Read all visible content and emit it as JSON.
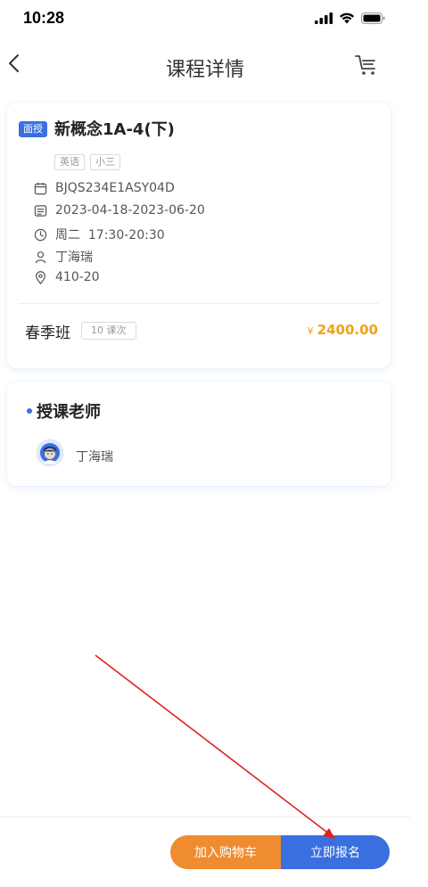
{
  "status_bar": {
    "time": "10:28"
  },
  "nav": {
    "title": "课程详情"
  },
  "course": {
    "mode_badge": "面授",
    "title": "新概念1A-4(下)",
    "tags": [
      "英语",
      "小三"
    ],
    "info": [
      {
        "icon": "calendar-icon",
        "text": "BJQS234E1ASY04D"
      },
      {
        "icon": "date-range-icon",
        "text": "2023-04-18-2023-06-20"
      },
      {
        "icon": "clock-icon",
        "text": "周二  17:30-20:30"
      },
      {
        "icon": "person-icon",
        "text": "丁海瑞"
      },
      {
        "icon": "location-icon",
        "text": "410-20"
      }
    ],
    "term": "春季班",
    "lesson_count": "10 课次",
    "price_currency": "¥",
    "price": "2400.00"
  },
  "teacher_section": {
    "title": "授课老师",
    "teacher_name": "丁海瑞"
  },
  "bottom_bar": {
    "add_to_cart_label": "加入购物车",
    "enroll_label": "立即报名"
  },
  "colors": {
    "accent_blue": "#3a6fe0",
    "orange": "#f08c30",
    "price": "#f2a218",
    "annotation_arrow": "#e02020"
  }
}
